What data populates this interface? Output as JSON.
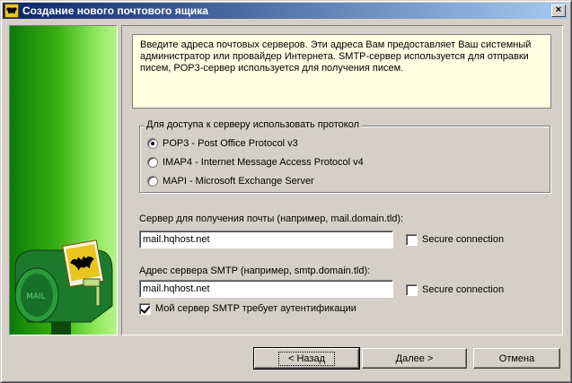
{
  "window": {
    "title": "Создание нового почтового ящика",
    "close_label": "×"
  },
  "info_text": "Введите адреса почтовых серверов. Эти адреса Вам предоставляет Ваш системный администратор или провайдер Интернета. SMTP-сервер используется для отправки писем, POP3-сервер используется для получения писем.",
  "protocol_group": {
    "legend": "Для доступа к серверу использовать протокол",
    "options": [
      {
        "label": "POP3 - Post Office Protocol v3",
        "selected": true
      },
      {
        "label": "IMAP4 - Internet Message Access Protocol v4",
        "selected": false
      },
      {
        "label": "MAPI - Microsoft Exchange Server",
        "selected": false
      }
    ]
  },
  "incoming": {
    "label": "Сервер для получения почты  (например, mail.domain.tld):",
    "value": "mail.hqhost.net",
    "secure_label": "Secure connection",
    "secure_checked": false
  },
  "smtp": {
    "label": "Адрес сервера SMTP (например, smtp.domain.tld):",
    "value": "mail.hqhost.net",
    "secure_label": "Secure connection",
    "secure_checked": false,
    "auth_label": "Мой сервер SMTP требует аутентификации",
    "auth_checked": true
  },
  "buttons": {
    "back": "<  Назад",
    "next": "Далее  >",
    "cancel": "Отмена"
  },
  "banner": {
    "mailbox_text": "MAIL",
    "icon": "mailbox-illustration"
  }
}
